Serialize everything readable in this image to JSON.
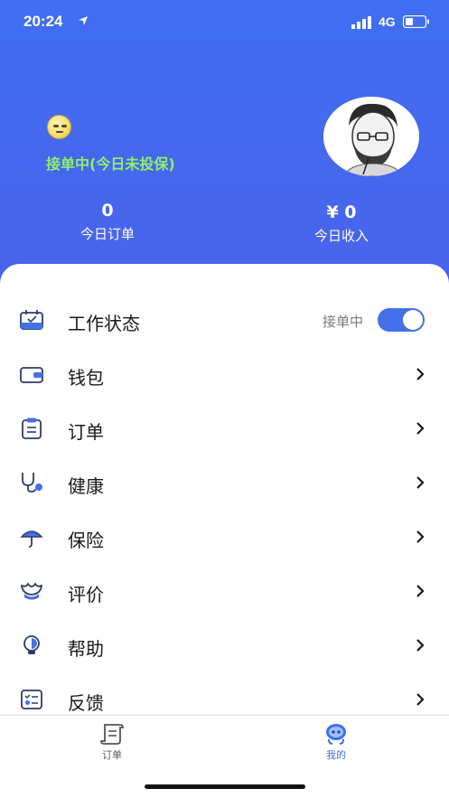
{
  "status_bar": {
    "time": "20:24",
    "network": "4G"
  },
  "header": {
    "emoji_icon": "dizzy-face-emoji",
    "work_status_text": "接单中(今日未投保)",
    "today_orders": {
      "value": "0",
      "label": "今日订单"
    },
    "today_income": {
      "value": "¥ 0",
      "label": "今日收入"
    }
  },
  "colors": {
    "accent": "#3f6ef2",
    "status_green": "#8ff06a"
  },
  "menu": {
    "work_status": {
      "label": "工作状态",
      "toggle_text": "接单中",
      "toggle_on": true,
      "icon": "calendar-check-icon"
    },
    "items": [
      {
        "label": "钱包",
        "icon": "wallet-icon"
      },
      {
        "label": "订单",
        "icon": "clipboard-icon"
      },
      {
        "label": "健康",
        "icon": "stethoscope-icon"
      },
      {
        "label": "保险",
        "icon": "umbrella-icon"
      },
      {
        "label": "评价",
        "icon": "lotus-icon"
      },
      {
        "label": "帮助",
        "icon": "lightbulb-icon"
      },
      {
        "label": "反馈",
        "icon": "checklist-icon"
      }
    ]
  },
  "tabbar": {
    "tabs": [
      {
        "label": "订单",
        "icon": "scroll-icon",
        "active": false
      },
      {
        "label": "我的",
        "icon": "robot-face-icon",
        "active": true
      }
    ]
  }
}
